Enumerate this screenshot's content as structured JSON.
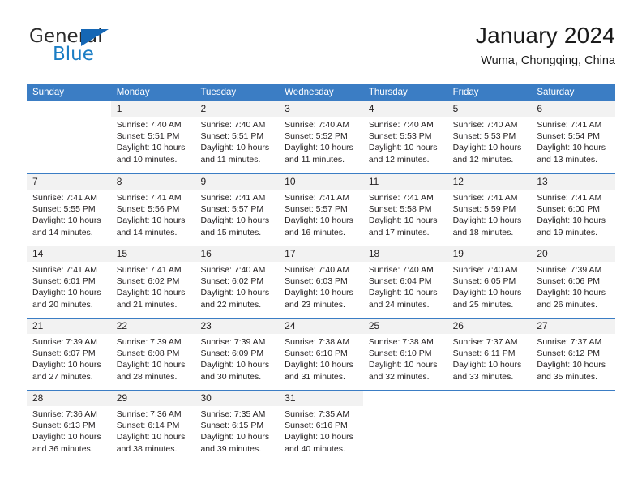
{
  "brand": {
    "name_part1": "General",
    "name_part2": "Blue"
  },
  "header": {
    "title": "January 2024",
    "subtitle": "Wuma, Chongqing, China"
  },
  "colors": {
    "header_blue": "#3b7dc4",
    "brand_blue": "#1a7dc4",
    "day_band": "#f2f2f2",
    "text": "#231f20"
  },
  "weekdays": [
    "Sunday",
    "Monday",
    "Tuesday",
    "Wednesday",
    "Thursday",
    "Friday",
    "Saturday"
  ],
  "weeks": [
    [
      {
        "day": "",
        "sunrise": "",
        "sunset": "",
        "daylight_line1": "",
        "daylight_line2": ""
      },
      {
        "day": "1",
        "sunrise": "Sunrise: 7:40 AM",
        "sunset": "Sunset: 5:51 PM",
        "daylight_line1": "Daylight: 10 hours",
        "daylight_line2": "and 10 minutes."
      },
      {
        "day": "2",
        "sunrise": "Sunrise: 7:40 AM",
        "sunset": "Sunset: 5:51 PM",
        "daylight_line1": "Daylight: 10 hours",
        "daylight_line2": "and 11 minutes."
      },
      {
        "day": "3",
        "sunrise": "Sunrise: 7:40 AM",
        "sunset": "Sunset: 5:52 PM",
        "daylight_line1": "Daylight: 10 hours",
        "daylight_line2": "and 11 minutes."
      },
      {
        "day": "4",
        "sunrise": "Sunrise: 7:40 AM",
        "sunset": "Sunset: 5:53 PM",
        "daylight_line1": "Daylight: 10 hours",
        "daylight_line2": "and 12 minutes."
      },
      {
        "day": "5",
        "sunrise": "Sunrise: 7:40 AM",
        "sunset": "Sunset: 5:53 PM",
        "daylight_line1": "Daylight: 10 hours",
        "daylight_line2": "and 12 minutes."
      },
      {
        "day": "6",
        "sunrise": "Sunrise: 7:41 AM",
        "sunset": "Sunset: 5:54 PM",
        "daylight_line1": "Daylight: 10 hours",
        "daylight_line2": "and 13 minutes."
      }
    ],
    [
      {
        "day": "7",
        "sunrise": "Sunrise: 7:41 AM",
        "sunset": "Sunset: 5:55 PM",
        "daylight_line1": "Daylight: 10 hours",
        "daylight_line2": "and 14 minutes."
      },
      {
        "day": "8",
        "sunrise": "Sunrise: 7:41 AM",
        "sunset": "Sunset: 5:56 PM",
        "daylight_line1": "Daylight: 10 hours",
        "daylight_line2": "and 14 minutes."
      },
      {
        "day": "9",
        "sunrise": "Sunrise: 7:41 AM",
        "sunset": "Sunset: 5:57 PM",
        "daylight_line1": "Daylight: 10 hours",
        "daylight_line2": "and 15 minutes."
      },
      {
        "day": "10",
        "sunrise": "Sunrise: 7:41 AM",
        "sunset": "Sunset: 5:57 PM",
        "daylight_line1": "Daylight: 10 hours",
        "daylight_line2": "and 16 minutes."
      },
      {
        "day": "11",
        "sunrise": "Sunrise: 7:41 AM",
        "sunset": "Sunset: 5:58 PM",
        "daylight_line1": "Daylight: 10 hours",
        "daylight_line2": "and 17 minutes."
      },
      {
        "day": "12",
        "sunrise": "Sunrise: 7:41 AM",
        "sunset": "Sunset: 5:59 PM",
        "daylight_line1": "Daylight: 10 hours",
        "daylight_line2": "and 18 minutes."
      },
      {
        "day": "13",
        "sunrise": "Sunrise: 7:41 AM",
        "sunset": "Sunset: 6:00 PM",
        "daylight_line1": "Daylight: 10 hours",
        "daylight_line2": "and 19 minutes."
      }
    ],
    [
      {
        "day": "14",
        "sunrise": "Sunrise: 7:41 AM",
        "sunset": "Sunset: 6:01 PM",
        "daylight_line1": "Daylight: 10 hours",
        "daylight_line2": "and 20 minutes."
      },
      {
        "day": "15",
        "sunrise": "Sunrise: 7:41 AM",
        "sunset": "Sunset: 6:02 PM",
        "daylight_line1": "Daylight: 10 hours",
        "daylight_line2": "and 21 minutes."
      },
      {
        "day": "16",
        "sunrise": "Sunrise: 7:40 AM",
        "sunset": "Sunset: 6:02 PM",
        "daylight_line1": "Daylight: 10 hours",
        "daylight_line2": "and 22 minutes."
      },
      {
        "day": "17",
        "sunrise": "Sunrise: 7:40 AM",
        "sunset": "Sunset: 6:03 PM",
        "daylight_line1": "Daylight: 10 hours",
        "daylight_line2": "and 23 minutes."
      },
      {
        "day": "18",
        "sunrise": "Sunrise: 7:40 AM",
        "sunset": "Sunset: 6:04 PM",
        "daylight_line1": "Daylight: 10 hours",
        "daylight_line2": "and 24 minutes."
      },
      {
        "day": "19",
        "sunrise": "Sunrise: 7:40 AM",
        "sunset": "Sunset: 6:05 PM",
        "daylight_line1": "Daylight: 10 hours",
        "daylight_line2": "and 25 minutes."
      },
      {
        "day": "20",
        "sunrise": "Sunrise: 7:39 AM",
        "sunset": "Sunset: 6:06 PM",
        "daylight_line1": "Daylight: 10 hours",
        "daylight_line2": "and 26 minutes."
      }
    ],
    [
      {
        "day": "21",
        "sunrise": "Sunrise: 7:39 AM",
        "sunset": "Sunset: 6:07 PM",
        "daylight_line1": "Daylight: 10 hours",
        "daylight_line2": "and 27 minutes."
      },
      {
        "day": "22",
        "sunrise": "Sunrise: 7:39 AM",
        "sunset": "Sunset: 6:08 PM",
        "daylight_line1": "Daylight: 10 hours",
        "daylight_line2": "and 28 minutes."
      },
      {
        "day": "23",
        "sunrise": "Sunrise: 7:39 AM",
        "sunset": "Sunset: 6:09 PM",
        "daylight_line1": "Daylight: 10 hours",
        "daylight_line2": "and 30 minutes."
      },
      {
        "day": "24",
        "sunrise": "Sunrise: 7:38 AM",
        "sunset": "Sunset: 6:10 PM",
        "daylight_line1": "Daylight: 10 hours",
        "daylight_line2": "and 31 minutes."
      },
      {
        "day": "25",
        "sunrise": "Sunrise: 7:38 AM",
        "sunset": "Sunset: 6:10 PM",
        "daylight_line1": "Daylight: 10 hours",
        "daylight_line2": "and 32 minutes."
      },
      {
        "day": "26",
        "sunrise": "Sunrise: 7:37 AM",
        "sunset": "Sunset: 6:11 PM",
        "daylight_line1": "Daylight: 10 hours",
        "daylight_line2": "and 33 minutes."
      },
      {
        "day": "27",
        "sunrise": "Sunrise: 7:37 AM",
        "sunset": "Sunset: 6:12 PM",
        "daylight_line1": "Daylight: 10 hours",
        "daylight_line2": "and 35 minutes."
      }
    ],
    [
      {
        "day": "28",
        "sunrise": "Sunrise: 7:36 AM",
        "sunset": "Sunset: 6:13 PM",
        "daylight_line1": "Daylight: 10 hours",
        "daylight_line2": "and 36 minutes."
      },
      {
        "day": "29",
        "sunrise": "Sunrise: 7:36 AM",
        "sunset": "Sunset: 6:14 PM",
        "daylight_line1": "Daylight: 10 hours",
        "daylight_line2": "and 38 minutes."
      },
      {
        "day": "30",
        "sunrise": "Sunrise: 7:35 AM",
        "sunset": "Sunset: 6:15 PM",
        "daylight_line1": "Daylight: 10 hours",
        "daylight_line2": "and 39 minutes."
      },
      {
        "day": "31",
        "sunrise": "Sunrise: 7:35 AM",
        "sunset": "Sunset: 6:16 PM",
        "daylight_line1": "Daylight: 10 hours",
        "daylight_line2": "and 40 minutes."
      },
      {
        "day": "",
        "sunrise": "",
        "sunset": "",
        "daylight_line1": "",
        "daylight_line2": ""
      },
      {
        "day": "",
        "sunrise": "",
        "sunset": "",
        "daylight_line1": "",
        "daylight_line2": ""
      },
      {
        "day": "",
        "sunrise": "",
        "sunset": "",
        "daylight_line1": "",
        "daylight_line2": ""
      }
    ]
  ]
}
